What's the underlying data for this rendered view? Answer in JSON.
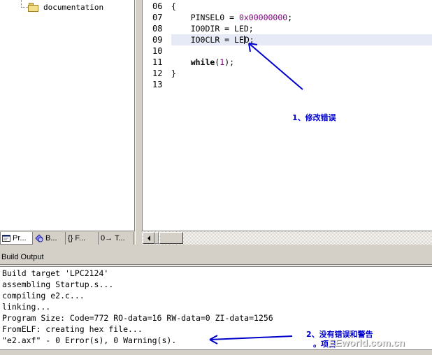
{
  "project_tree": {
    "folder_label": "documentation"
  },
  "project_tabs": [
    {
      "label": "Pr...",
      "icon": "project-window-icon"
    },
    {
      "label": "B...",
      "icon": "books-icon"
    },
    {
      "label": "{} F...",
      "icon": "functions-icon"
    },
    {
      "label": "0→ T...",
      "icon": "templates-icon"
    }
  ],
  "editor": {
    "line_numbers": [
      "06",
      "07",
      "08",
      "09",
      "10",
      "11",
      "12",
      "13"
    ],
    "lines": {
      "l06": "{",
      "l07_name": "PINSEL0 = ",
      "l07_value": "0x00000000",
      "l07_end": ";",
      "l08": "IO0DIR = LED;",
      "l09_before": "IO0CLR = LE",
      "l09_after": "D;",
      "l11_kw": "while",
      "l11_open": "(",
      "l11_num": "1",
      "l11_close": ");",
      "l12": "}"
    },
    "current_line": "09"
  },
  "output": {
    "title": "Build Output",
    "lines": [
      "Build target 'LPC2124'",
      "assembling Startup.s...",
      "compiling e2.c...",
      "linking...",
      "Program Size: Code=772 RO-data=16 RW-data=0 ZI-data=1256",
      "FromELF: creating hex file...",
      "\"e2.axf\" - 0 Error(s), 0 Warning(s)."
    ]
  },
  "annotations": {
    "note1": "1、修改错误",
    "note2": "2、没有错误和警告",
    "note2_sub": "。项目",
    "color": "#0000cc"
  },
  "watermark": "EEworld.com.cn"
}
